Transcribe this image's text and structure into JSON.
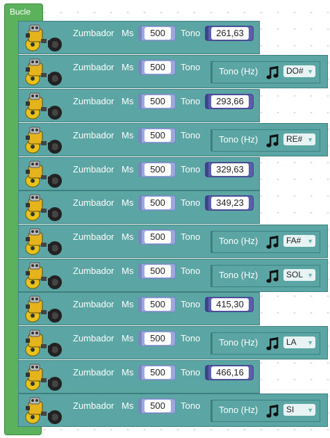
{
  "loop": {
    "label": "Bucle"
  },
  "block_text": {
    "zumbador": "Zumbador",
    "ms": "Ms",
    "tono": "Tono",
    "tono_hz": "Tono (Hz)"
  },
  "blocks": [
    {
      "ms": "500",
      "tone": "261,63"
    },
    {
      "ms": "500",
      "note": "DO#"
    },
    {
      "ms": "500",
      "tone": "293,66"
    },
    {
      "ms": "500",
      "note": "RE#"
    },
    {
      "ms": "500",
      "tone": "329,63"
    },
    {
      "ms": "500",
      "tone": "349,23"
    },
    {
      "ms": "500",
      "note": "FA#"
    },
    {
      "ms": "500",
      "note": "SOL"
    },
    {
      "ms": "500",
      "tone": "415,30"
    },
    {
      "ms": "500",
      "note": "LA"
    },
    {
      "ms": "500",
      "tone": "466,16"
    },
    {
      "ms": "500",
      "note": "SI"
    }
  ],
  "colors": {
    "loop": "#5cb25c",
    "block": "#5ba5a5",
    "ms_socket": "#9aa8e0",
    "tone_socket": "#5b5eaa"
  },
  "icons": {
    "robot": "robot-buzzer-icon",
    "note": "music-note-icon",
    "dropdown": "dropdown-arrow-icon"
  }
}
